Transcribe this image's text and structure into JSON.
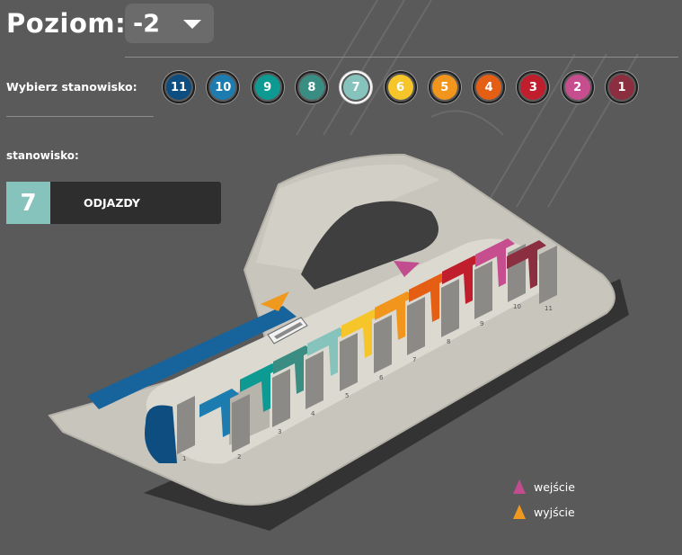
{
  "header": {
    "title": "Poziom:",
    "level_value": "-2"
  },
  "stand_selector": {
    "label": "Wybierz stanowisko:",
    "stands": [
      {
        "label": "11",
        "color": "#0e4d80"
      },
      {
        "label": "10",
        "color": "#1c7cb0"
      },
      {
        "label": "9",
        "color": "#0d9a93"
      },
      {
        "label": "8",
        "color": "#3a8d83"
      },
      {
        "label": "7",
        "color": "#86c3bc"
      },
      {
        "label": "6",
        "color": "#f6c52a"
      },
      {
        "label": "5",
        "color": "#f1951c"
      },
      {
        "label": "4",
        "color": "#e45e13"
      },
      {
        "label": "3",
        "color": "#c11e2d"
      },
      {
        "label": "2",
        "color": "#c64d8e"
      },
      {
        "label": "1",
        "color": "#8b2e40"
      }
    ],
    "selected": "7"
  },
  "stand_info": {
    "label": "stanowisko:",
    "number": "7",
    "name": "ODJAZDY",
    "color": "#86c3bc"
  },
  "map": {
    "entrance_color": "#c24d8e",
    "exit_color": "#ef9a1e",
    "bay_numbers": [
      "11",
      "10",
      "9",
      "8",
      "7",
      "6",
      "5",
      "4",
      "3",
      "2",
      "1"
    ]
  },
  "legend": {
    "entrance": "wejście",
    "exit": "wyjście"
  }
}
